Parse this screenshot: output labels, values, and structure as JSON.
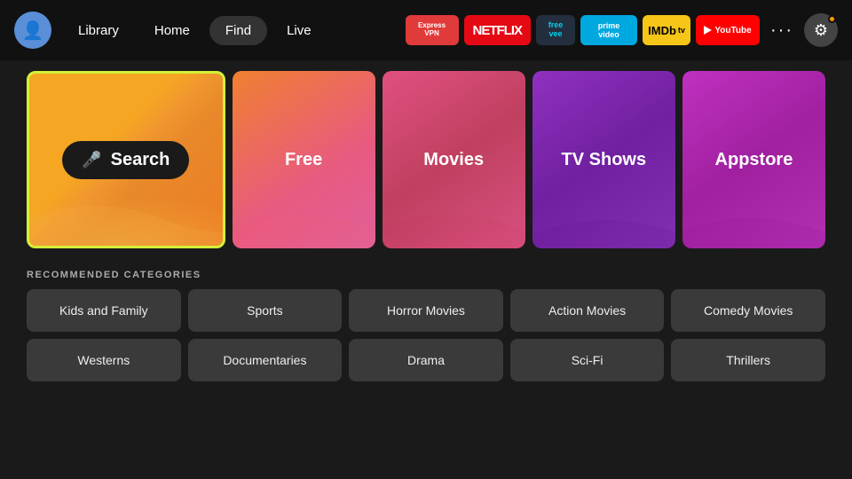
{
  "nav": {
    "library_label": "Library",
    "home_label": "Home",
    "find_label": "Find",
    "live_label": "Live",
    "active": "Find"
  },
  "apps": [
    {
      "name": "expressvpn",
      "label": "ExpressVPN"
    },
    {
      "name": "netflix",
      "label": "NETFLIX"
    },
    {
      "name": "freevee",
      "label": "freevee"
    },
    {
      "name": "prime",
      "label": "prime video"
    },
    {
      "name": "imdb",
      "label": "IMDb tv"
    },
    {
      "name": "youtube",
      "label": "YouTube"
    },
    {
      "name": "more",
      "label": "···"
    }
  ],
  "tiles": [
    {
      "id": "search",
      "label": "Search"
    },
    {
      "id": "free",
      "label": "Free"
    },
    {
      "id": "movies",
      "label": "Movies"
    },
    {
      "id": "tvshows",
      "label": "TV Shows"
    },
    {
      "id": "appstore",
      "label": "Appstore"
    }
  ],
  "recommended": {
    "section_title": "RECOMMENDED CATEGORIES",
    "row1": [
      "Kids and Family",
      "Sports",
      "Horror Movies",
      "Action Movies",
      "Comedy Movies"
    ],
    "row2": [
      "Westerns",
      "Documentaries",
      "Drama",
      "Sci-Fi",
      "Thrillers"
    ]
  },
  "colors": {
    "accent_green": "#d4f038",
    "nav_active": "#333333",
    "bg": "#1a1a1a"
  }
}
